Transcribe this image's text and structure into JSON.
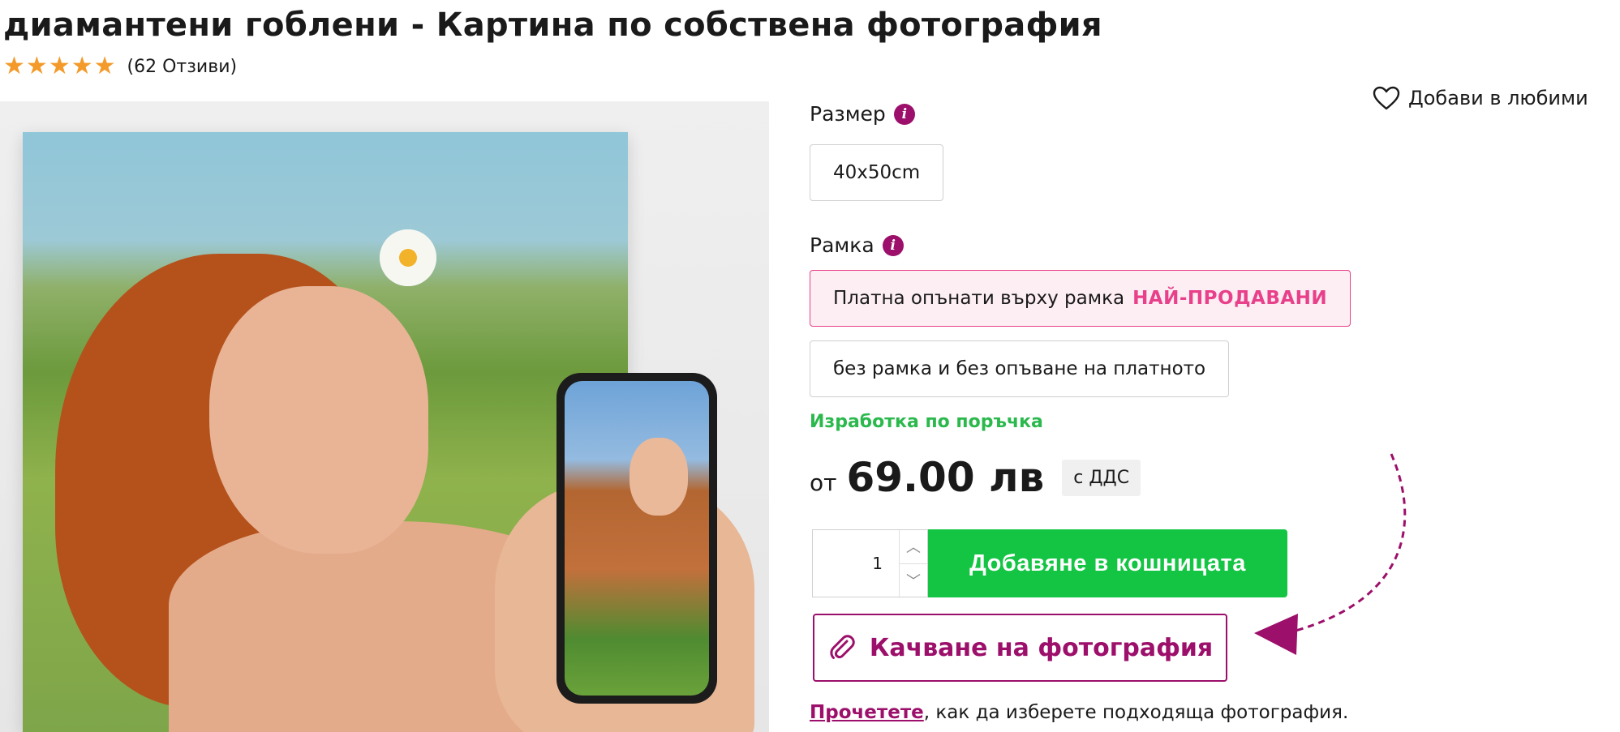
{
  "title": "диамантени гоблени - Картина по собствена фотография",
  "rating": {
    "stars": 5,
    "reviews_text": "(62 Отзиви)",
    "star_color": "#f39a2a"
  },
  "favorites": {
    "label": "Добави в любими",
    "icon": "heart-icon"
  },
  "size": {
    "label": "Размер",
    "info_icon": "i",
    "options": [
      "40x50cm"
    ]
  },
  "frame": {
    "label": "Рамка",
    "info_icon": "i",
    "options": [
      {
        "label": "Платна опънати върху рамка",
        "badge": "НАЙ-ПРОДАВАНИ",
        "selected": true
      },
      {
        "label": "без рамка и без опъване на платното",
        "selected": false
      }
    ]
  },
  "made_to_order": "Изработка по поръчка",
  "price": {
    "prefix": "от",
    "value": "69.00 лв",
    "vat": "с ДДС"
  },
  "quantity": {
    "value": "1"
  },
  "add_to_cart_label": "Добавяне в кошницата",
  "upload_label": "Качване на фотография",
  "read_more": {
    "link": "Прочетете",
    "text": ", как да изберете подходяща фотография."
  },
  "colors": {
    "accent": "#9c0f6a",
    "bestseller": "#e8408a",
    "cart_button": "#14c443",
    "made_to_order": "#2bb84c"
  }
}
